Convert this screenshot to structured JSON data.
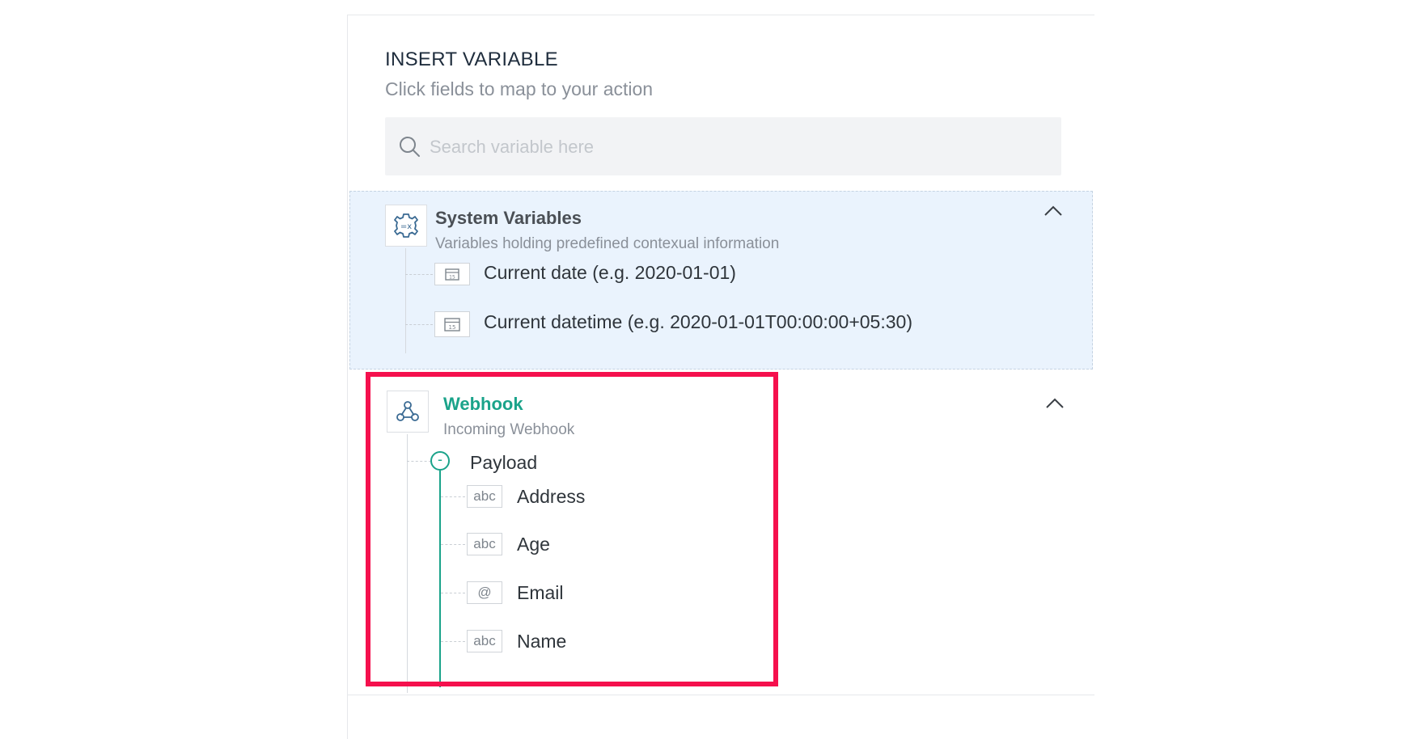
{
  "header": {
    "title": "INSERT VARIABLE",
    "subtitle": "Click fields to map to your action"
  },
  "search": {
    "placeholder": "Search variable here",
    "value": ""
  },
  "system_variables": {
    "title": "System Variables",
    "description": "Variables holding predefined contexual information",
    "icon": "gear-variable-icon",
    "items": [
      {
        "label": "Current date (e.g. 2020-01-01)",
        "icon": "calendar-icon"
      },
      {
        "label": "Current datetime (e.g. 2020-01-01T00:00:00+05:30)",
        "icon": "calendar-icon"
      }
    ]
  },
  "webhook": {
    "title": "Webhook",
    "description": "Incoming Webhook",
    "icon": "webhook-icon",
    "payload": {
      "label": "Payload",
      "toggle": "-",
      "fields": [
        {
          "type": "abc",
          "label": "Address"
        },
        {
          "type": "abc",
          "label": "Age"
        },
        {
          "type": "@",
          "label": "Email"
        },
        {
          "type": "abc",
          "label": "Name"
        }
      ]
    }
  },
  "colors": {
    "accent": "#1aa38a",
    "highlight": "#f5104d",
    "section_bg": "#eaf3fd"
  }
}
